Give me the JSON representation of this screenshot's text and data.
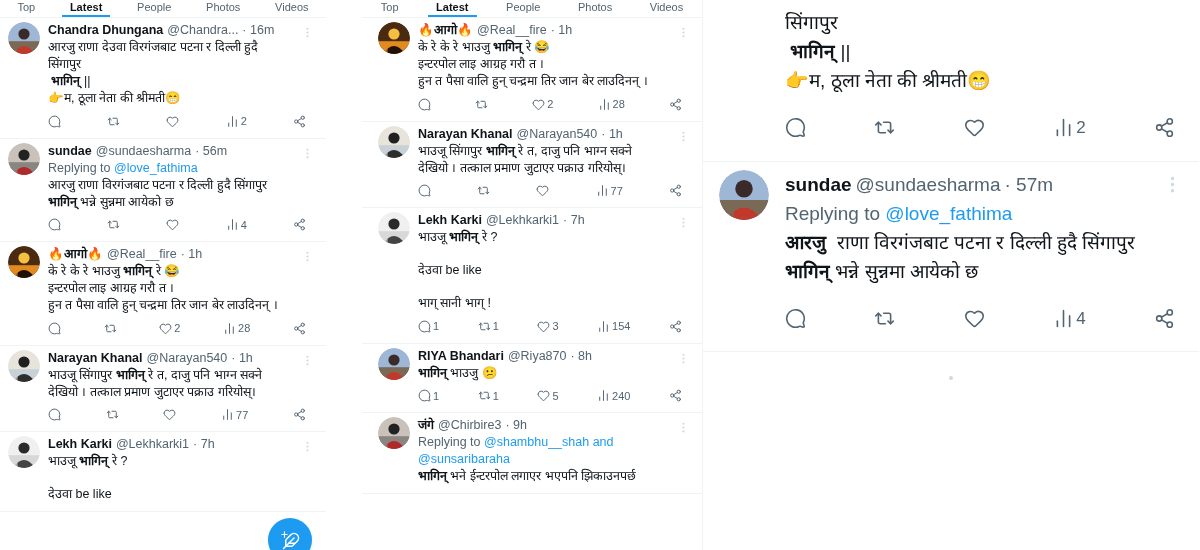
{
  "panels": [
    {
      "tabs": [
        {
          "label": "Top",
          "selected": false
        },
        {
          "label": "Latest",
          "selected": true
        },
        {
          "label": "People",
          "selected": false
        },
        {
          "label": "Photos",
          "selected": false
        },
        {
          "label": "Videos",
          "selected": false
        }
      ],
      "compose_button": true,
      "reply_label": "Replying to",
      "tweets": [
        {
          "name": "Chandra Dhungana",
          "handle": "@Chandra...",
          "time": "· 16m",
          "paragraphs": [
            [
              "आरजु राणा देउवा विरगंजबाट पटना र दिल्ली हुदै",
              "सिंगापुर",
              " **भागिन्** ||",
              "👉म, ठूला नेता की श्रीमती😁"
            ]
          ],
          "stats": {
            "views": "2"
          }
        },
        {
          "name": "sundae",
          "handle": "@sundaesharma",
          "time": "· 56m",
          "reply_to": [
            "@love_fathima"
          ],
          "paragraphs": [
            [
              "आरजु राणा विरगंजबाट पटना र दिल्ली हुदै सिंगापुर",
              "**भागिन्** भन्ने सुन्नमा आयेको छ"
            ]
          ],
          "stats": {
            "views": "4"
          }
        },
        {
          "name": "🔥आगो🔥",
          "handle": "@Real__fire",
          "time": "· 1h",
          "paragraphs": [
            [
              "के रे के रे भाउजु **भागिन्** रे 😂",
              "इन्टरपोल लाइ आग्रह गरौ त ।",
              "हुन त पैसा वालि हुन् चन्द्रमा तिर जान बेर लाउदिनन् ।"
            ]
          ],
          "stats": {
            "likes": "2",
            "views": "28"
          }
        },
        {
          "name": "Narayan Khanal",
          "handle": "@Narayan540",
          "time": "· 1h",
          "paragraphs": [
            [
              "भाउजू सिंगापुर **भागिन्** रे त, दाजु पनि भाग्न सक्ने",
              "देखियो । तत्काल प्रमाण जुटाएर पक्राउ गरियोस्।"
            ]
          ],
          "stats": {
            "views": "77"
          }
        },
        {
          "name": "Lekh Karki",
          "handle": "@Lekhkarki1",
          "time": "· 7h",
          "paragraphs": [
            [
              "भाउजू **भागिन्** रे ?"
            ],
            [
              "देउवा be like"
            ]
          ]
        }
      ]
    },
    {
      "tabs": [
        {
          "label": "Top",
          "selected": false
        },
        {
          "label": "Latest",
          "selected": true
        },
        {
          "label": "People",
          "selected": false
        },
        {
          "label": "Photos",
          "selected": false
        },
        {
          "label": "Videos",
          "selected": false
        }
      ],
      "reply_label": "Replying to",
      "tweets": [
        {
          "name": "🔥आगो🔥",
          "handle": "@Real__fire",
          "time": "· 1h",
          "paragraphs": [
            [
              "के रे के रे भाउजु **भागिन्** रे 😂",
              "इन्टरपोल लाइ आग्रह गरौ त ।",
              "हुन त पैसा वालि हुन् चन्द्रमा तिर जान बेर लाउदिनन् ।"
            ]
          ],
          "stats": {
            "likes": "2",
            "views": "28"
          }
        },
        {
          "name": "Narayan Khanal",
          "handle": "@Narayan540",
          "time": "· 1h",
          "paragraphs": [
            [
              "भाउजू सिंगापुर **भागिन्** रे त, दाजु पनि भाग्न सक्ने",
              "देखियो । तत्काल प्रमाण जुटाएर पक्राउ गरियोस्।"
            ]
          ],
          "stats": {
            "views": "77"
          }
        },
        {
          "name": "Lekh Karki",
          "handle": "@Lekhkarki1",
          "time": "· 7h",
          "paragraphs": [
            [
              "भाउजू **भागिन्** रे ?"
            ],
            [
              "देउवा be like"
            ],
            [
              "भाग् सानी भाग् !"
            ]
          ],
          "stats": {
            "replies": "1",
            "reposts": "1",
            "likes": "3",
            "views": "154"
          }
        },
        {
          "name": "RIYA Bhandari",
          "handle": "@Riya870",
          "time": "· 8h",
          "paragraphs": [
            [
              "**भागिन्** भाउजु 😕"
            ]
          ],
          "stats": {
            "replies": "1",
            "reposts": "1",
            "likes": "5",
            "views": "240"
          }
        },
        {
          "name": "जंगे",
          "handle": "@Chirbire3",
          "time": "· 9h",
          "reply_to": [
            "@shambhu__shah and",
            "@sunsaribaraha"
          ],
          "paragraphs": [
            [
              "**भागिन्** भने ईन्टरपोल लगाएर भएपनि झिकाउनपर्छ"
            ]
          ]
        }
      ]
    },
    {
      "loading": true,
      "reply_label": "Replying to",
      "tweets": [
        {
          "kind": "continuation",
          "paragraphs": [
            [
              "सिंगापुर",
              " **भागिन्** ||",
              "👉म, ठूला नेता की श्रीमती😁"
            ]
          ],
          "stats": {
            "views": "2"
          }
        },
        {
          "kind": "tweet",
          "name": "sundae",
          "handle": "@sundaesharma",
          "time": "· 57m",
          "reply_to": [
            "@love_fathima"
          ],
          "paragraphs": [
            [
              "**आरजु**  राणा विरगंजबाट पटना र दिल्ली हुदै सिंगापुर",
              "**भागिन्** भन्ने सुन्नमा आयेको छ"
            ]
          ],
          "stats": {
            "views": "4"
          }
        }
      ]
    }
  ]
}
